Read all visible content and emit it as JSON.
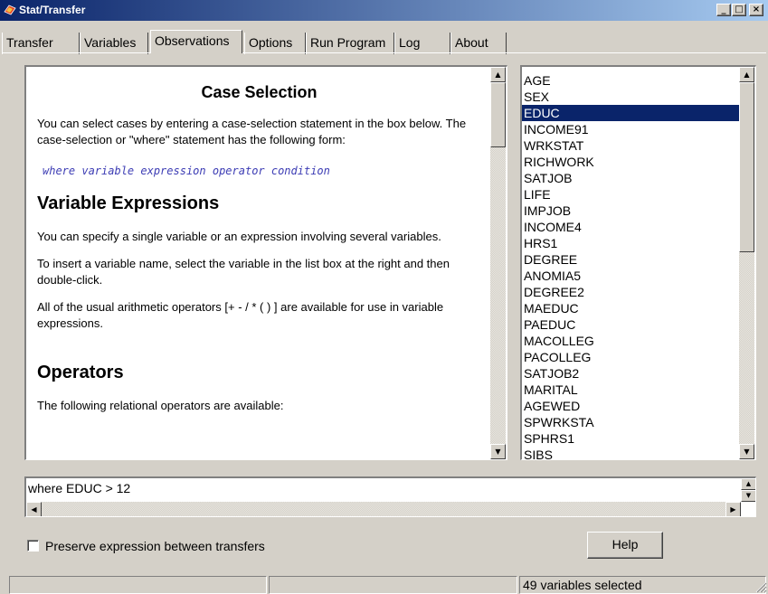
{
  "window": {
    "title": "Stat/Transfer",
    "minimize_glyph": "_",
    "maximize_glyph": "□",
    "close_glyph": "×"
  },
  "tabs": [
    {
      "label": "Transfer",
      "active": false
    },
    {
      "label": "Variables",
      "active": false
    },
    {
      "label": "Observations",
      "active": true
    },
    {
      "label": "Options",
      "active": false
    },
    {
      "label": "Run Program",
      "active": false
    },
    {
      "label": "Log",
      "active": false
    },
    {
      "label": "About",
      "active": false
    }
  ],
  "help": {
    "heading": "Case Selection",
    "intro": "You can select cases by entering a case-selection statement in the box below. The case-selection or \"where\" statement has the following form:",
    "syntax": "where variable expression operator condition",
    "section_var_expr": "Variable Expressions",
    "para1": "You can specify a single variable or an expression involving several variables.",
    "para2": "To insert a variable name, select the variable in the list box at the right and then double-click.",
    "para3": "All of the usual arithmetic operators [+ - / * ( ) ] are available for use in variable expressions.",
    "section_operators": "Operators",
    "para4": "The following relational operators are available:"
  },
  "variables": {
    "items": [
      "AGE",
      "SEX",
      "EDUC",
      "INCOME91",
      "WRKSTAT",
      "RICHWORK",
      "SATJOB",
      "LIFE",
      "IMPJOB",
      "INCOME4",
      "HRS1",
      "DEGREE",
      "ANOMIA5",
      "DEGREE2",
      "MAEDUC",
      "PAEDUC",
      "MACOLLEG",
      "PACOLLEG",
      "SATJOB2",
      "MARITAL",
      "AGEWED",
      "SPWRKSTA",
      "SPHRS1",
      "SIBS"
    ],
    "selected": "EDUC"
  },
  "expression": {
    "value": "where EDUC > 12"
  },
  "preserve": {
    "label": "Preserve expression between transfers",
    "checked": false
  },
  "buttons": {
    "help": "Help"
  },
  "status": {
    "panel1": "",
    "panel2": "",
    "panel3": "49 variables selected"
  },
  "colors": {
    "titlebar_start": "#0a246a",
    "titlebar_end": "#a6caf0",
    "selection": "#0a246a",
    "code_text": "#3c3cb4",
    "face": "#d4d0c8"
  },
  "icons": {
    "app": "stat-transfer-logo-icon",
    "scroll_up": "▲",
    "scroll_down": "▼",
    "scroll_left": "◀",
    "scroll_right": "▶"
  }
}
